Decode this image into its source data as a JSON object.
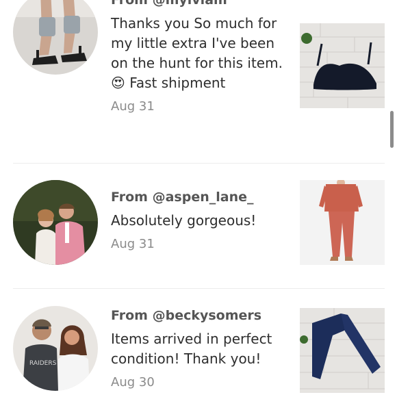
{
  "reviews": [
    {
      "from": "From @mylviam",
      "message": "Thanks you So much for my little extra I've been on the hunt for this item.😍 Fast shipment",
      "date": "Aug 31"
    },
    {
      "from": "From @aspen_lane_",
      "message": "Absolutely gorgeous!",
      "date": "Aug 31"
    },
    {
      "from": "From @beckysomers",
      "message": "Items arrived in perfect condition! Thank you!",
      "date": "Aug 30"
    }
  ],
  "colors": {
    "divider": "#ececec",
    "date": "#8a8a8a",
    "from": "#555555"
  }
}
